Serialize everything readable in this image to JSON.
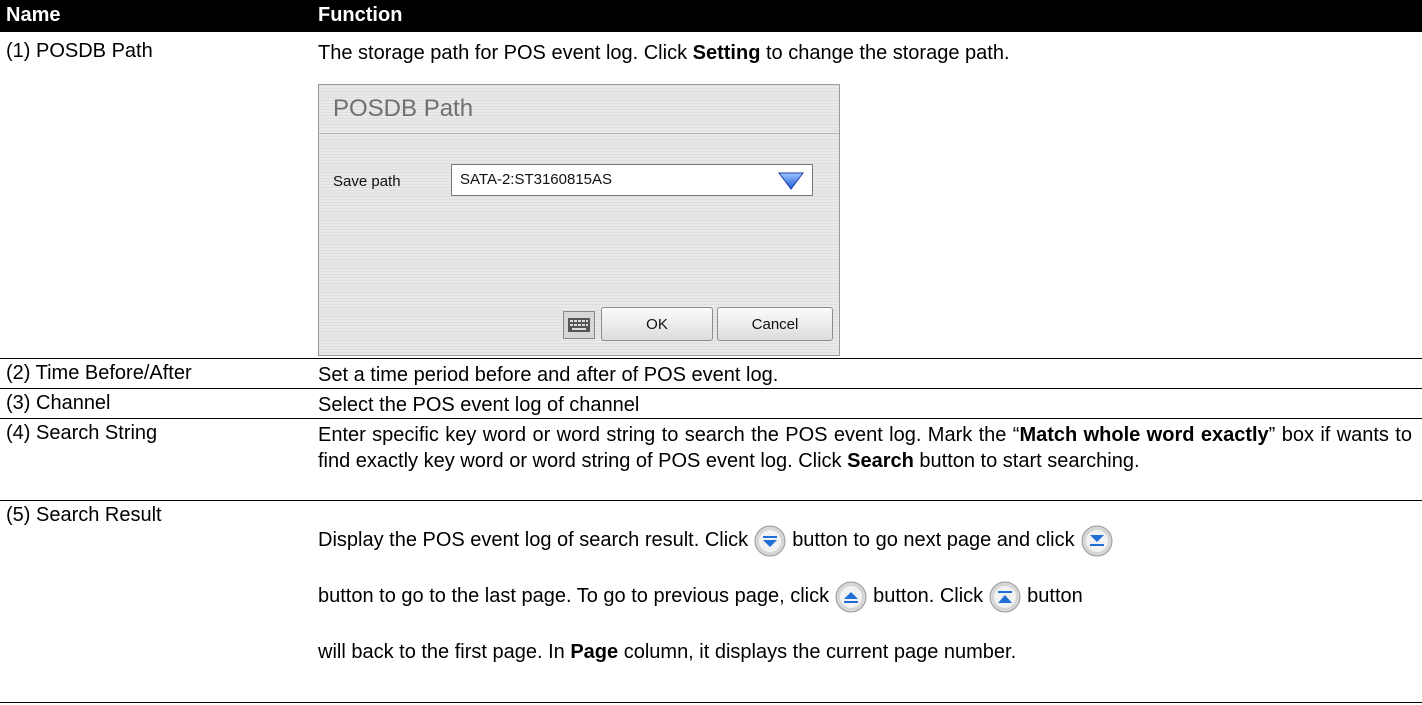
{
  "header": {
    "name": "Name",
    "function": "Function"
  },
  "rows": [
    {
      "name": "(1) POSDB Path",
      "desc_a": "The storage path for POS event log. Click ",
      "desc_b": "Setting",
      "desc_c": " to change the storage path."
    },
    {
      "name": "(2) Time Before/After",
      "desc": "Set a time period before and after of POS event log."
    },
    {
      "name": "(3) Channel",
      "desc": "Select the POS event log of channel"
    },
    {
      "name": "(4) Search String",
      "a": "Enter specific key word or word string to search the POS event log. Mark the “",
      "b": "Match whole word exactly",
      "c": "” box if wants to find exactly key word or word string of POS event log. Click ",
      "d": "Search",
      "e": " button to start searching."
    },
    {
      "name": "(5) Search Result",
      "a": "Display the POS event log of search result. Click",
      "b": "button to go next page and click",
      "c": "button to go to the last page. To go to previous page, click",
      "d": "button. Click",
      "e": "button",
      "f": "will back to the first page. In ",
      "g": "Page",
      "h": " column, it displays the current page number."
    }
  ],
  "dialog": {
    "title": "POSDB Path",
    "save_label": "Save path",
    "save_value": "SATA-2:ST3160815AS",
    "ok": "OK",
    "cancel": "Cancel",
    "icons": {
      "dropdown": "triangle-down-icon",
      "keyboard": "keyboard-icon"
    }
  },
  "icons": [
    "next-page-icon",
    "last-page-icon",
    "previous-page-icon",
    "first-page-icon"
  ]
}
